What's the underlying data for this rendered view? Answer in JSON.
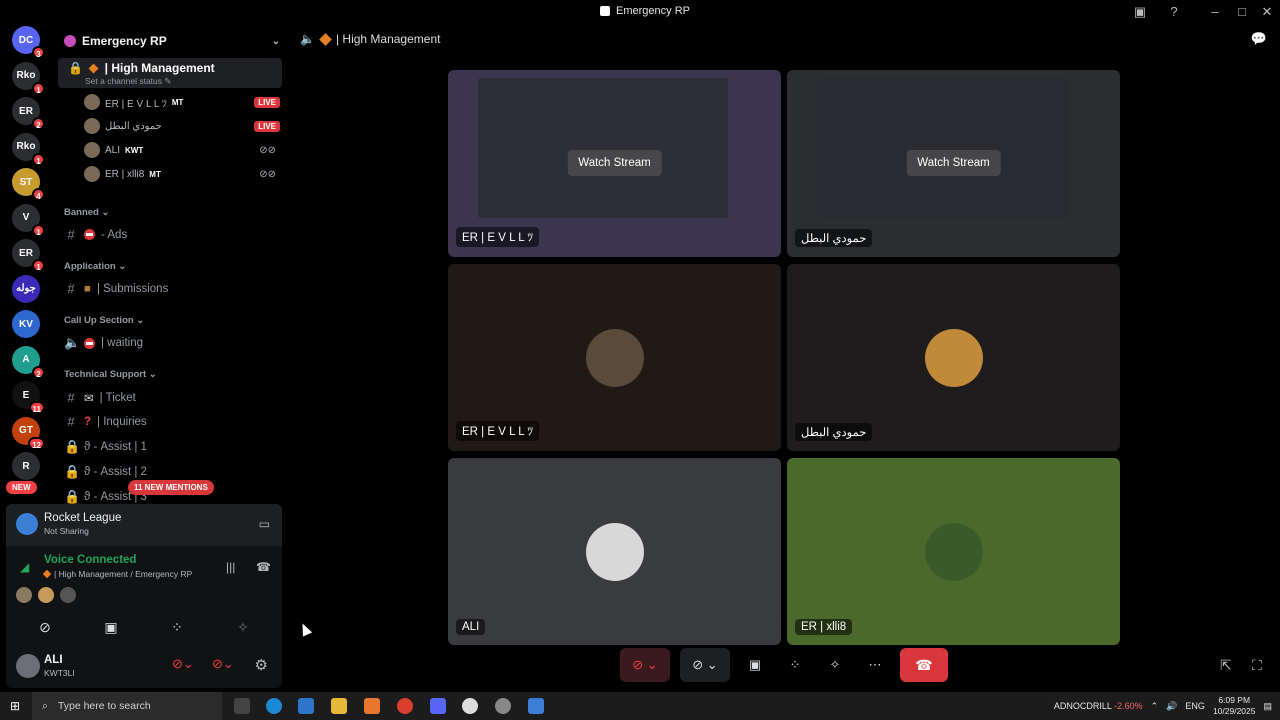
{
  "window": {
    "title": "Emergency RP"
  },
  "servers": [
    {
      "label": "DC",
      "badge": "3",
      "color": "#5865f2"
    },
    {
      "label": "Rko",
      "badge": "1",
      "color": "#2b2d31"
    },
    {
      "label": "ER",
      "badge": "2",
      "color": "#2b2d31"
    },
    {
      "label": "Rko",
      "badge": "1",
      "color": "#2b2d31"
    },
    {
      "label": "ST",
      "badge": "4",
      "color": "#c99a2e"
    },
    {
      "label": "V",
      "badge": "1",
      "color": "#2b2d31"
    },
    {
      "label": "ER",
      "badge": "1",
      "color": "#2b2d31"
    },
    {
      "label": "جوله",
      "badge": "",
      "color": "#3b2ab8"
    },
    {
      "label": "KV",
      "badge": "",
      "color": "#2f66d0"
    },
    {
      "label": "A",
      "badge": "2",
      "color": "#1f9e8f"
    },
    {
      "label": "E",
      "badge": "11",
      "color": "#111"
    },
    {
      "label": "GT",
      "badge": "12",
      "color": "#c2410c"
    },
    {
      "label": "R",
      "badge": "",
      "color": "#2b2d31"
    }
  ],
  "new_label": "NEW",
  "guild": {
    "name": "Emergency RP"
  },
  "active_channel": {
    "name": "| High Management",
    "status": "Set a channel status"
  },
  "voice_users": [
    {
      "name": "ER | E V L L ﾂ",
      "tag": "MT",
      "live": "LIVE"
    },
    {
      "name": "حمودي البطل",
      "tag": "",
      "live": "LIVE"
    },
    {
      "name": "ALI",
      "tag": "KWT",
      "live": ""
    },
    {
      "name": "ER | xlli8",
      "tag": "MT",
      "live": ""
    }
  ],
  "categories": {
    "banned": "Banned",
    "application": "Application",
    "callup": "Call Up Section",
    "tech": "Technical Support"
  },
  "channels": {
    "ads": "- Ads",
    "submissions": "| Submissions",
    "waiting": "| waiting",
    "ticket": "| Ticket",
    "inquiries": "| Inquiries",
    "assist1": "ϑ - Assist | 1",
    "assist2": "ϑ - Assist | 2",
    "assist3": "ϑ - Assist | 3"
  },
  "mentions_pill": "11 NEW MENTIONS",
  "game": {
    "name": "Rocket League",
    "status": "Not Sharing"
  },
  "voice_connection": {
    "title": "Voice Connected",
    "location": "| High Management / Emergency RP"
  },
  "user": {
    "name": "ALI",
    "sub": "KWT3LI"
  },
  "main_header": "| High Management",
  "tiles": [
    {
      "label": "ER | E V L L ﾂ",
      "watch": "Watch Stream",
      "bg": "#3b3550"
    },
    {
      "label": "حمودي البطل",
      "watch": "Watch Stream",
      "bg": "#2c2d31"
    },
    {
      "label": "ER | E V L L ﾂ",
      "watch": "",
      "bg": "#1f1a14"
    },
    {
      "label": "حمودي البطل",
      "watch": "",
      "bg": "#1e1c1c"
    },
    {
      "label": "ALI",
      "watch": "",
      "bg": "#3a3b3e"
    },
    {
      "label": "ER | xlli8",
      "watch": "",
      "bg": "#4a6a2c"
    }
  ],
  "taskbar": {
    "search_placeholder": "Type here to search",
    "stock": "ADNOCDRILL",
    "stock_change": "-2.60%",
    "lang": "ENG",
    "time": "6:09 PM",
    "date": "10/29/2025"
  }
}
